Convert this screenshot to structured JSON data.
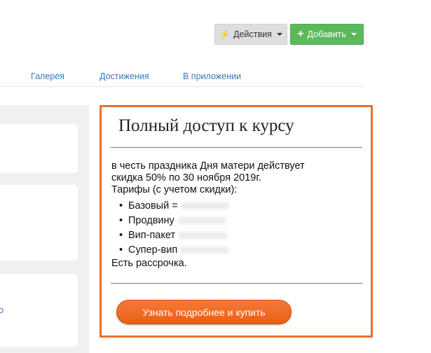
{
  "toolbar": {
    "actions_label": "Действия",
    "add_label": "Добавить"
  },
  "tabs": [
    {
      "label": "Галерея"
    },
    {
      "label": "Достижения"
    },
    {
      "label": "В приложении"
    }
  ],
  "left_panel": {
    "card_3_char": "o"
  },
  "promo": {
    "title": "Полный доступ к курсу",
    "intro_line_1": "в честь праздника Дня матери действует",
    "intro_line_2": "скидка 50% по 30 ноября 2019г.",
    "tariffs_heading": "Тарифы (с учетом скидки):",
    "tariffs": [
      {
        "name": "Базовый ="
      },
      {
        "name": "Продвину"
      },
      {
        "name": "Вип-пакет"
      },
      {
        "name": "Супер-вип"
      }
    ],
    "installment": "Есть рассрочка.",
    "cta_label": "Узнать подробнее и купить"
  },
  "colors": {
    "accent_orange": "#e86f2e",
    "add_green": "#5cb85c",
    "link_blue": "#3a78b6"
  }
}
